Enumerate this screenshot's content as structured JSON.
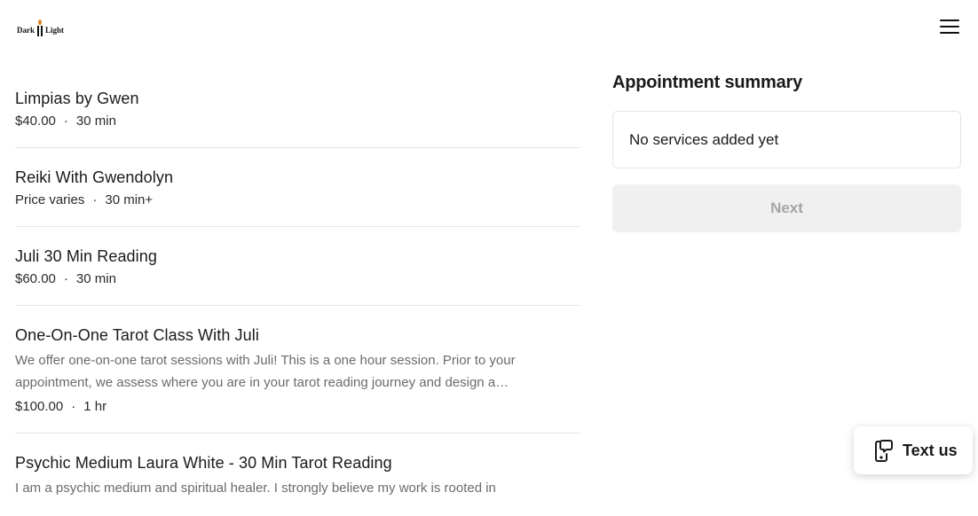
{
  "header": {
    "logo_left": "Dark",
    "logo_right": "Light",
    "menu_icon": "hamburger-menu-icon"
  },
  "services": [
    {
      "name": "Limpias by Gwen",
      "description": "",
      "price": "$40.00",
      "duration": "30 min"
    },
    {
      "name": "Reiki With Gwendolyn",
      "description": "",
      "price": "Price varies",
      "duration": "30 min+"
    },
    {
      "name": "Juli 30 Min Reading",
      "description": "",
      "price": "$60.00",
      "duration": "30 min"
    },
    {
      "name": "One-On-One Tarot Class With Juli",
      "description": "We offer one-on-one tarot sessions with Juli! This is a one hour session. Prior to your appointment, we assess where you are in your tarot reading journey and design a…",
      "price": "$100.00",
      "duration": "1 hr"
    },
    {
      "name": "Psychic Medium Laura White - 30 Min Tarot Reading",
      "description": "I am a psychic medium and spiritual healer. I strongly believe my work is rooted in",
      "price": "",
      "duration": ""
    }
  ],
  "meta_separator": "·",
  "summary": {
    "title": "Appointment summary",
    "empty_text": "No services added yet",
    "next_label": "Next"
  },
  "text_us": {
    "label": "Text us",
    "icon": "phone-message-icon"
  },
  "colors": {
    "text": "#1a1a1a",
    "muted": "#6b6b6b",
    "disabled_bg": "#f0f0f0",
    "disabled_text": "#a6a6a6"
  }
}
